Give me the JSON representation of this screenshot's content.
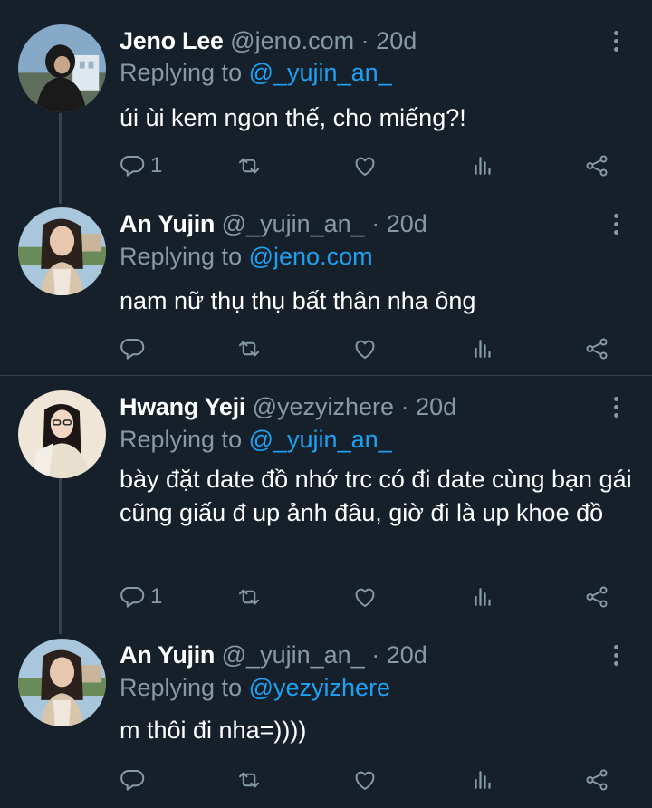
{
  "tweets": [
    {
      "name": "Jeno Lee",
      "handle": "@jeno.com",
      "dot": "·",
      "time": "20d",
      "reply_prefix": "Replying to",
      "reply_to": "@_yujin_an_",
      "text": "úi ùi kem ngon thế, cho miếng?!",
      "reply_count": "1",
      "avatar_colors": [
        "#87a9c8",
        "#dfe7ef",
        "#1a1a1a"
      ]
    },
    {
      "name": "An Yujin",
      "handle": "@_yujin_an_",
      "dot": "·",
      "time": "20d",
      "reply_prefix": "Replying to",
      "reply_to": "@jeno.com",
      "text": "nam nữ thụ thụ bất thân nha ông",
      "reply_count": "",
      "avatar_colors": [
        "#a9c7dc",
        "#d9c4ac",
        "#2b211d"
      ]
    },
    {
      "name": "Hwang Yeji",
      "handle": "@yezyizhere",
      "dot": "·",
      "time": "20d",
      "reply_prefix": "Replying to",
      "reply_to": "@_yujin_an_",
      "text": "bày đặt date đồ nhớ trc có đi date cùng bạn gái cũng giấu đ up ảnh đâu, giờ đi là up khoe đồ",
      "reply_count": "1",
      "avatar_colors": [
        "#efe6d8",
        "#e9dfcf",
        "#1c1616"
      ]
    },
    {
      "name": "An Yujin",
      "handle": "@_yujin_an_",
      "dot": "·",
      "time": "20d",
      "reply_prefix": "Replying to",
      "reply_to": "@yezyizhere",
      "text": "m thôi đi nha=))))",
      "reply_count": "",
      "avatar_colors": [
        "#a9c7dc",
        "#d9c4ac",
        "#2b211d"
      ]
    }
  ],
  "icons": {
    "reply": "reply-icon",
    "retweet": "retweet-icon",
    "like": "heart-icon",
    "stats": "stats-icon",
    "share": "share-icon",
    "more": "more-options-icon"
  },
  "colors": {
    "background": "#15202b",
    "text": "#ffffff",
    "muted": "#8899a6",
    "accent": "#1da1f2",
    "divider": "#38444d"
  }
}
